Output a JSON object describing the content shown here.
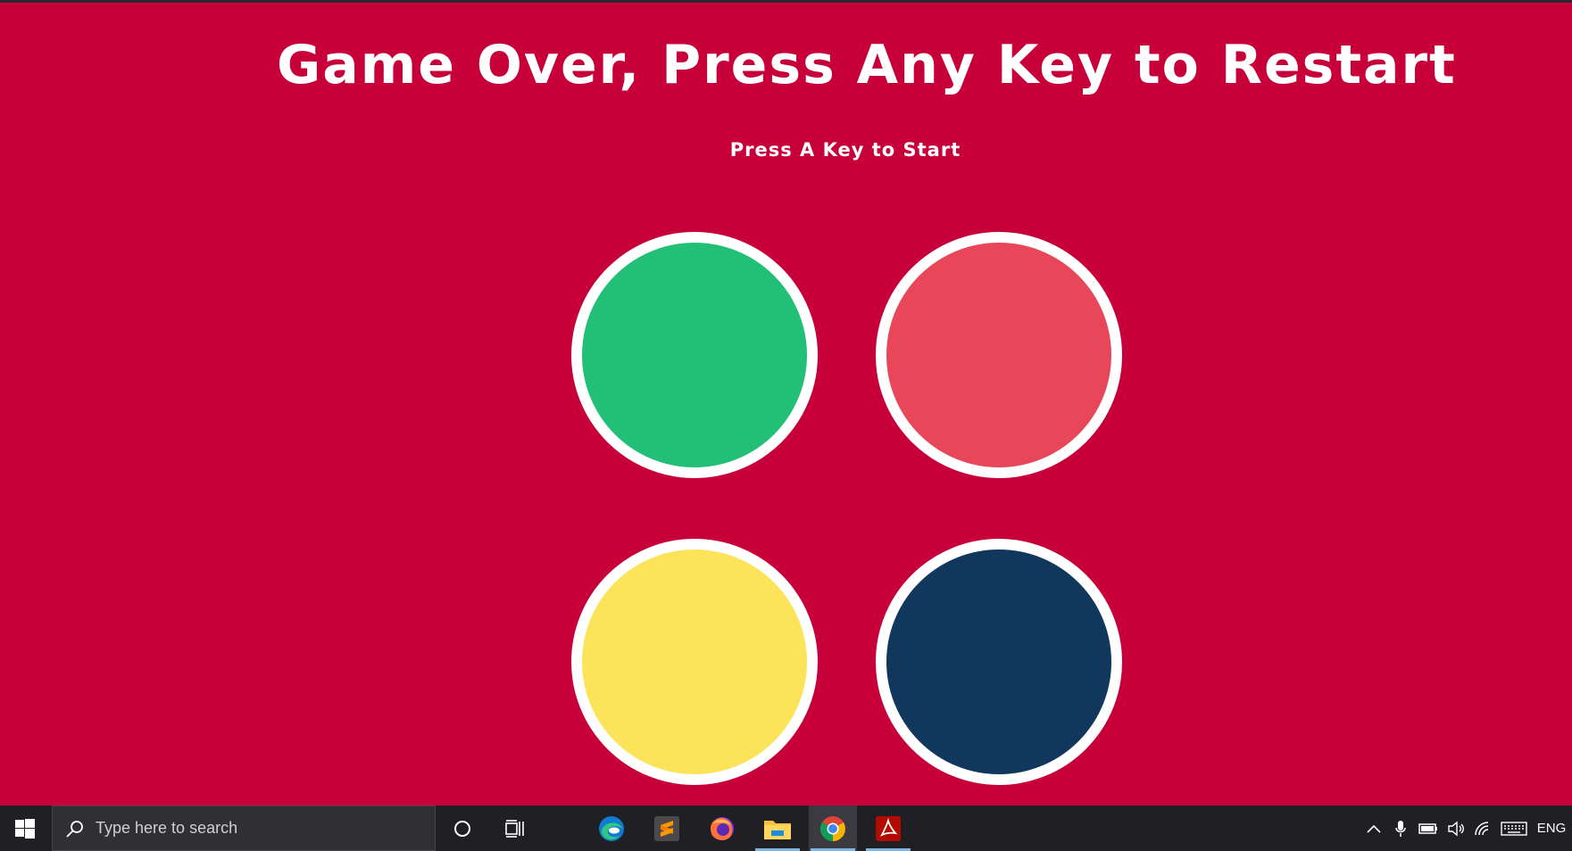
{
  "game": {
    "title": "Game Over, Press Any Key to Restart",
    "subtitle": "Press A Key to Start",
    "background_color": "#c70039",
    "pads": [
      {
        "id": "green",
        "color": "#22bf76"
      },
      {
        "id": "red",
        "color": "#e8475a"
      },
      {
        "id": "yellow",
        "color": "#fbe45a"
      },
      {
        "id": "blue",
        "color": "#12375c"
      }
    ]
  },
  "taskbar": {
    "search_placeholder": "Type here to search",
    "apps": [
      "edge-icon",
      "sublime-text-icon",
      "firefox-icon",
      "file-explorer-icon",
      "chrome-icon",
      "acrobat-icon"
    ],
    "active_app": "chrome-icon",
    "language": "ENG"
  }
}
